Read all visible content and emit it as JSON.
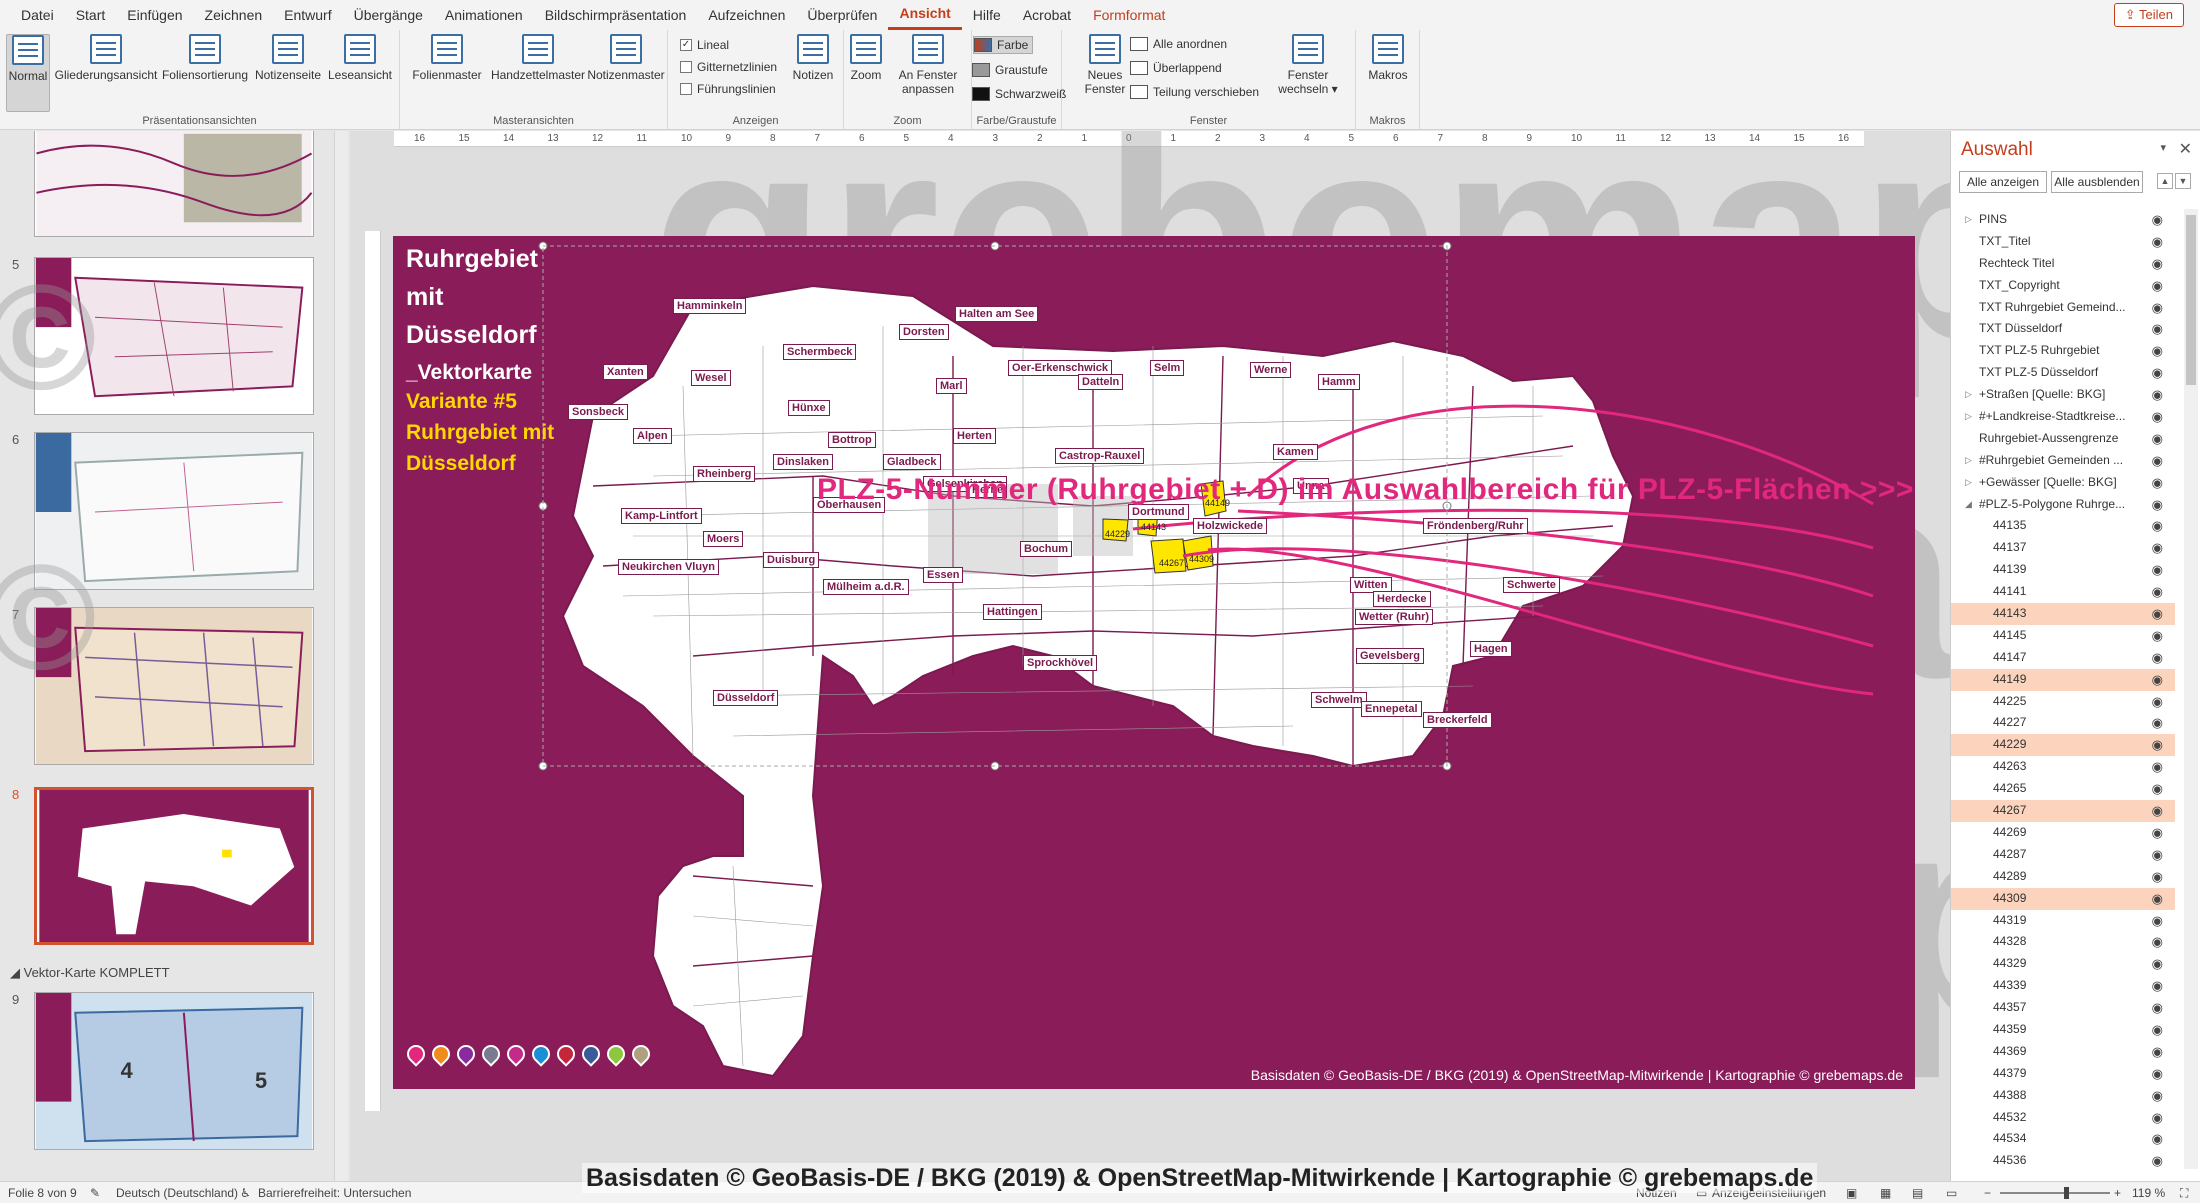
{
  "menu": [
    "Datei",
    "Start",
    "Einfügen",
    "Zeichnen",
    "Entwurf",
    "Übergänge",
    "Animationen",
    "Bildschirmpräsentation",
    "Aufzeichnen",
    "Überprüfen",
    "Ansicht",
    "Hilfe",
    "Acrobat",
    "Formformat"
  ],
  "menu_active": "Ansicht",
  "share_label": "Teilen",
  "ribbon": {
    "praes": {
      "label": "Präsentationsansichten",
      "buttons": [
        "Normal",
        "Gliederungsansicht",
        "Foliensortierung",
        "Notizenseite",
        "Leseansicht"
      ]
    },
    "master": {
      "label": "Masteransichten",
      "buttons": [
        "Folienmaster",
        "Handzettelmaster",
        "Notizenmaster"
      ]
    },
    "anzeigen": {
      "label": "Anzeigen",
      "checks": [
        "Lineal",
        "Gitternetzlinien",
        "Führungslinien"
      ],
      "notes": "Notizen"
    },
    "zoom": {
      "label": "Zoom",
      "zoom": "Zoom",
      "fit": "An Fenster anpassen"
    },
    "farbe": {
      "label": "Farbe/Graustufe",
      "items": [
        "Farbe",
        "Graustufe",
        "Schwarzweiß"
      ]
    },
    "fenster": {
      "label": "Fenster",
      "new": "Neues Fenster",
      "items": [
        "Alle anordnen",
        "Überlappend",
        "Teilung verschieben"
      ],
      "switch": "Fenster wechseln"
    },
    "makros": {
      "label": "Makros",
      "btn": "Makros"
    }
  },
  "thumbs": {
    "numbers": [
      "5",
      "6",
      "7",
      "8",
      "9"
    ],
    "section": "Vektor-Karte KOMPLETT"
  },
  "ruler_marks": [
    "16",
    "15",
    "14",
    "13",
    "12",
    "11",
    "10",
    "9",
    "8",
    "7",
    "6",
    "5",
    "4",
    "3",
    "2",
    "1",
    "0",
    "1",
    "2",
    "3",
    "4",
    "5",
    "6",
    "7",
    "8",
    "9",
    "10",
    "11",
    "12",
    "13",
    "14",
    "15",
    "16"
  ],
  "slide": {
    "title_lines": [
      "Ruhrgebiet",
      "mit",
      "Düsseldorf",
      "_Vektorkarte"
    ],
    "sub_lines": [
      "Variante #5",
      "Ruhrgebiet mit",
      "Düsseldorf"
    ],
    "callout": "PLZ-5-Nummer (Ruhrgebiet + D) im Auswahlbereich für PLZ-5-Flächen >>>",
    "credit": "Basisdaten © GeoBasis-DE / BKG (2019) & OpenStreetMap-Mitwirkende | Kartographie © grebemaps.de",
    "pin_colors": [
      "#e2287d",
      "#f08c1e",
      "#8a2a9e",
      "#7a7a90",
      "#c42a8a",
      "#1a8fd6",
      "#c4263c",
      "#3a5a9a",
      "#8dc63f",
      "#b0a080"
    ],
    "cities": [
      "Hamminkeln",
      "Halten am See",
      "Dorsten",
      "Schermbeck",
      "Xanten",
      "Wesel",
      "Oer-Erkenschwick",
      "Selm",
      "Werne",
      "Marl",
      "Datteln",
      "Hamm",
      "Sonsbeck",
      "Hünxe",
      "Alpen",
      "Bottrop",
      "Dinslaken",
      "Gladbeck",
      "Herten",
      "Castrop-Rauxel",
      "Kamen",
      "Rheinberg",
      "Gelsenkirchen",
      "Herne",
      "Unna",
      "Dortmund",
      "Holzwickede",
      "Fröndenberg/Ruhr",
      "Kamp-Lintfort",
      "Oberhausen",
      "Moers",
      "Bochum",
      "Duisburg",
      "Essen",
      "Witten",
      "Schwerte",
      "Neukirchen Vluyn",
      "Mülheim a.d.R.",
      "Herdecke",
      "Hattingen",
      "Wetter (Ruhr)",
      "Hagen",
      "Gevelsberg",
      "Sprockhövel",
      "Schwelm",
      "Ennepetal",
      "Breckerfeld",
      "Düsseldorf"
    ],
    "highlight_codes": [
      "44143",
      "44149",
      "44229",
      "44267",
      "44309"
    ],
    "watermark": "grebemaps"
  },
  "pane": {
    "title": "Auswahl",
    "show_all": "Alle anzeigen",
    "hide_all": "Alle ausblenden",
    "items": [
      {
        "name": "PINS",
        "expand": true
      },
      {
        "name": "TXT_Titel"
      },
      {
        "name": "Rechteck Titel"
      },
      {
        "name": "TXT_Copyright"
      },
      {
        "name": "TXT Ruhrgebiet Gemeind..."
      },
      {
        "name": "TXT Düsseldorf"
      },
      {
        "name": "TXT PLZ-5 Ruhrgebiet"
      },
      {
        "name": "TXT PLZ-5 Düsseldorf"
      },
      {
        "name": "+Straßen [Quelle: BKG]",
        "expand": true
      },
      {
        "name": "#+Landkreise-Stadtkreise...",
        "expand": true
      },
      {
        "name": "Ruhrgebiet-Aussengrenze"
      },
      {
        "name": "#Ruhrgebiet Gemeinden ...",
        "expand": true
      },
      {
        "name": "+Gewässer [Quelle: BKG]",
        "expand": true
      },
      {
        "name": "#PLZ-5-Polygone Ruhrge...",
        "expand": true,
        "open": true
      },
      {
        "name": "44135",
        "indent": true
      },
      {
        "name": "44137",
        "indent": true
      },
      {
        "name": "44139",
        "indent": true
      },
      {
        "name": "44141",
        "indent": true
      },
      {
        "name": "44143",
        "indent": true,
        "hl": true
      },
      {
        "name": "44145",
        "indent": true
      },
      {
        "name": "44147",
        "indent": true
      },
      {
        "name": "44149",
        "indent": true,
        "hl": true
      },
      {
        "name": "44225",
        "indent": true
      },
      {
        "name": "44227",
        "indent": true
      },
      {
        "name": "44229",
        "indent": true,
        "hl": true
      },
      {
        "name": "44263",
        "indent": true
      },
      {
        "name": "44265",
        "indent": true
      },
      {
        "name": "44267",
        "indent": true,
        "hl": true
      },
      {
        "name": "44269",
        "indent": true
      },
      {
        "name": "44287",
        "indent": true
      },
      {
        "name": "44289",
        "indent": true
      },
      {
        "name": "44309",
        "indent": true,
        "hl": true
      },
      {
        "name": "44319",
        "indent": true
      },
      {
        "name": "44328",
        "indent": true
      },
      {
        "name": "44329",
        "indent": true
      },
      {
        "name": "44339",
        "indent": true
      },
      {
        "name": "44357",
        "indent": true
      },
      {
        "name": "44359",
        "indent": true
      },
      {
        "name": "44369",
        "indent": true
      },
      {
        "name": "44379",
        "indent": true
      },
      {
        "name": "44388",
        "indent": true
      },
      {
        "name": "44532",
        "indent": true
      },
      {
        "name": "44534",
        "indent": true
      },
      {
        "name": "44536",
        "indent": true
      }
    ]
  },
  "status": {
    "slide": "Folie 8 von 9",
    "lang": "Deutsch (Deutschland)",
    "access": "Barrierefreiheit: Untersuchen",
    "notes": "Notizen",
    "display": "Anzeigeeinstellungen",
    "zoom": "119 %"
  },
  "bottom_watermark": "Basisdaten © GeoBasis-DE / BKG (2019) & OpenStreetMap-Mitwirkende | Kartographie © grebemaps.de"
}
